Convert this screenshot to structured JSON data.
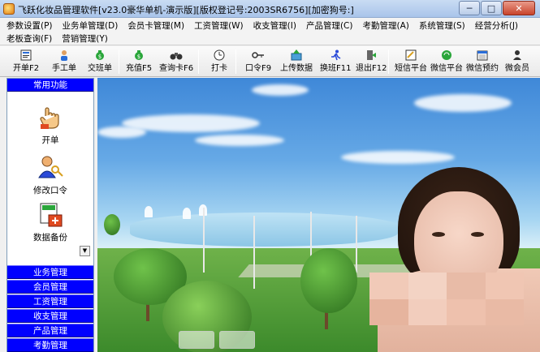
{
  "window": {
    "title": "飞跃化妆品管理软件[v23.0豪华单机-演示版][版权登记号:2003SR6756][加密狗号:]",
    "minimize": "─",
    "maximize": "□",
    "close": "✕"
  },
  "menu": [
    "参数设置(P)",
    "业务单管理(D)",
    "会员卡管理(M)",
    "工资管理(W)",
    "收支管理(I)",
    "产品管理(C)",
    "考勤管理(A)",
    "系统管理(S)",
    "经营分析(J)",
    "老板查询(F)",
    "营销管理(Y)"
  ],
  "toolbar": [
    {
      "label": "开单F2",
      "icon": "form-icon"
    },
    {
      "label": "手工单",
      "icon": "person-icon"
    },
    {
      "label": "交班单",
      "icon": "money-bag-icon"
    },
    {
      "label": "充值F5",
      "icon": "money-bag-icon"
    },
    {
      "label": "查询卡F6",
      "icon": "binoculars-icon"
    },
    {
      "label": "打卡",
      "icon": "clock-icon"
    },
    {
      "label": "口令F9",
      "icon": "key-icon"
    },
    {
      "label": "上传数据",
      "icon": "upload-icon"
    },
    {
      "label": "换班F11",
      "icon": "runner-icon"
    },
    {
      "label": "退出F12",
      "icon": "exit-icon"
    },
    {
      "label": "短信平台",
      "icon": "sms-icon"
    },
    {
      "label": "微信平台",
      "icon": "wechat-icon"
    },
    {
      "label": "微信预约",
      "icon": "calendar-icon"
    },
    {
      "label": "微会员",
      "icon": "member-icon"
    }
  ],
  "sidebar": {
    "header": "常用功能",
    "tools": [
      {
        "label": "开单",
        "icon": "hand-pointer-icon"
      },
      {
        "label": "修改口令",
        "icon": "person-key-icon"
      },
      {
        "label": "数据备份",
        "icon": "backup-icon"
      }
    ],
    "groups": [
      "业务管理",
      "会员管理",
      "工资管理",
      "收支管理",
      "产品管理",
      "考勤管理"
    ]
  },
  "colors": {
    "sidebar_blue": "#0000ff",
    "title_gradient_top": "#c9dcf3",
    "close_red": "#c8442b"
  }
}
